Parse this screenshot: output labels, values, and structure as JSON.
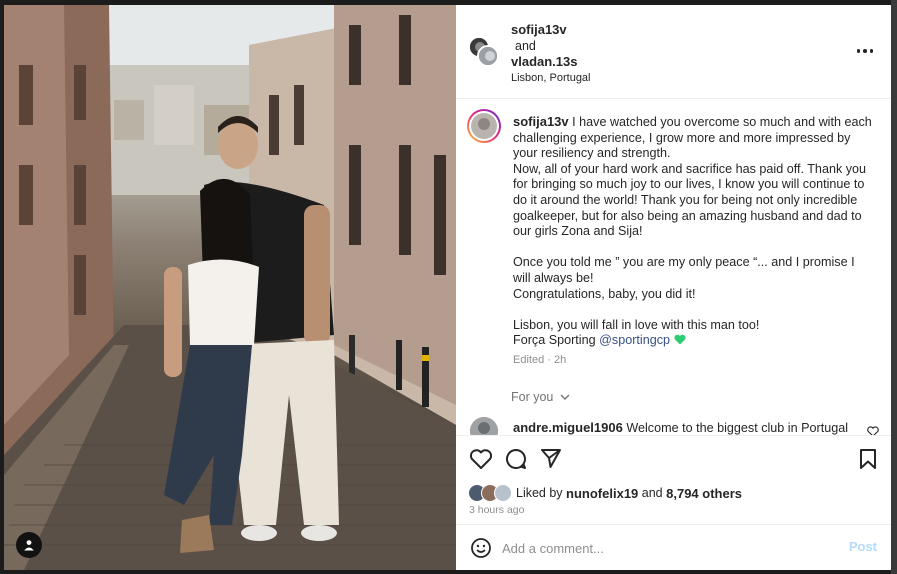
{
  "post": {
    "author": "sofija13v",
    "collab_word": "and",
    "collaborator": "vladan.13s",
    "location": "Lisbon, Portugal"
  },
  "caption": {
    "author": "sofija13v",
    "lines": [
      "I have watched you overcome so much and with each challenging experience, I grow more and more impressed by your resiliency and strength.",
      "Now, all of your hard work and sacrifice has paid off. Thank you for bringing so much joy to our lives, I know you will continue to do it around the world! Thank you for being not only incredible goalkeeper, but for also being an amazing husband and dad to our girls Zona and Sija!",
      "Once you told me ” you are my only peace “... and I promise I will always be!",
      "Congratulations, baby, you did it!",
      "Lisbon, you will fall in love with this man too!"
    ],
    "last_line_prefix": "Força Sporting",
    "mention": "@sportingcp",
    "edited": "Edited · 2h"
  },
  "for_you": "For you",
  "comment": {
    "user": "andre.miguel1906",
    "text": "Welcome to the biggest club in Portugal"
  },
  "likes": {
    "prefix": "Liked by",
    "user": "nunofelix19",
    "and": "and",
    "count": "8,794 others"
  },
  "time_ago": "3 hours ago",
  "add_comment": {
    "placeholder": "Add a comment...",
    "post_label": "Post"
  },
  "colors": {
    "heart_green": "#2ecc71",
    "link": "#385185",
    "post_disabled": "#b3dbff"
  },
  "icons": [
    "more-options-icon",
    "heart-icon",
    "comment-icon",
    "share-icon",
    "save-icon",
    "emoji-icon",
    "user-tag-icon",
    "chevron-down-icon",
    "small-heart-icon",
    "green-heart-icon"
  ]
}
